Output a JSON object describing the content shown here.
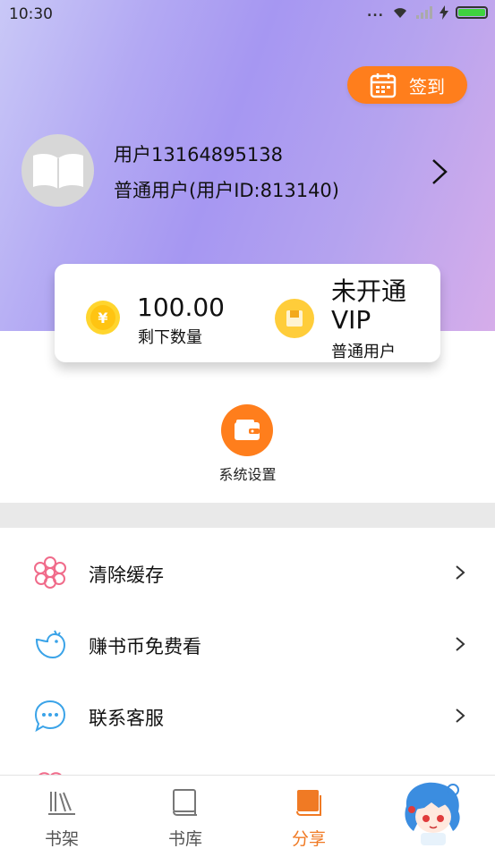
{
  "status_bar": {
    "time": "10:30",
    "dots": "..."
  },
  "header": {
    "checkin_label": "签到",
    "user_name": "用户13164895138",
    "user_type": "普通用户(用户ID:813140)"
  },
  "balance_card": {
    "coin_value": "100.00",
    "coin_label": "剩下数量",
    "vip_status": "未开通VIP",
    "vip_type": "普通用户"
  },
  "quick_actions": {
    "settings_label": "系统设置"
  },
  "menu": {
    "items": [
      {
        "label": "清除缓存",
        "icon": "flower-icon"
      },
      {
        "label": "赚书币免费看",
        "icon": "bird-icon"
      },
      {
        "label": "联系客服",
        "icon": "chat-bubble-icon"
      }
    ]
  },
  "tabbar": {
    "tabs": [
      {
        "label": "书架",
        "icon": "bookshelf-icon"
      },
      {
        "label": "书库",
        "icon": "library-icon"
      },
      {
        "label": "分享",
        "icon": "share-book-icon",
        "active": true
      },
      {
        "label": "",
        "icon": "mascot-icon"
      }
    ]
  },
  "colors": {
    "accent": "#ff7e1c",
    "menu_icon_pink": "#f06b8a",
    "menu_icon_blue": "#3aa3e8",
    "active_tab": "#f07a24"
  }
}
